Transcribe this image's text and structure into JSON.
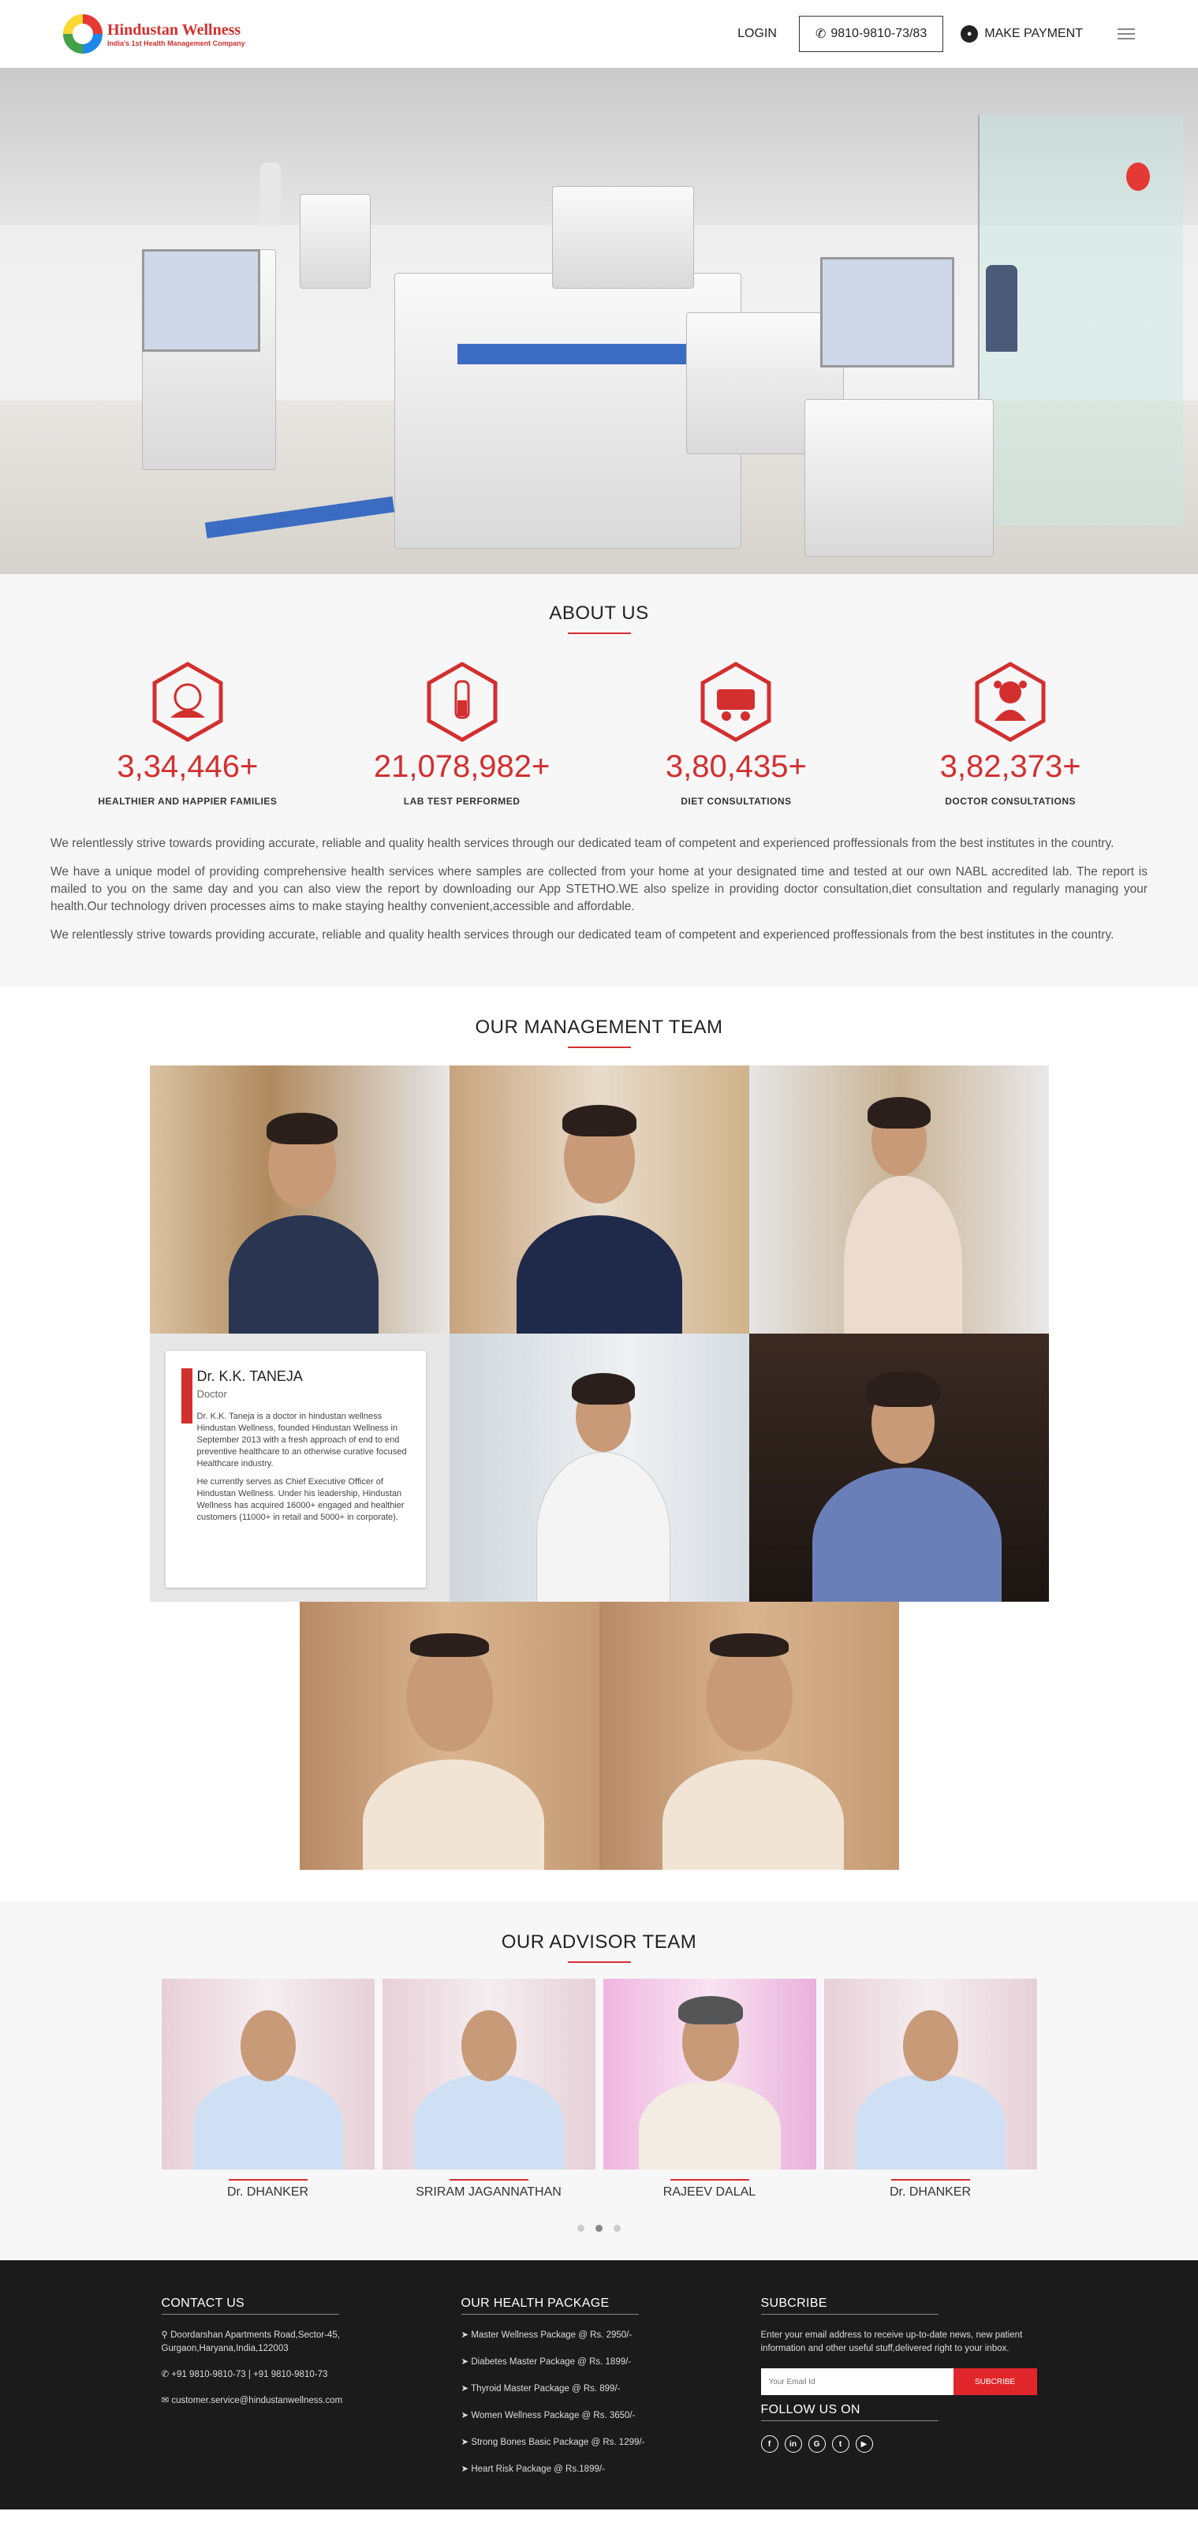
{
  "header": {
    "logo_title": "Hindustan Wellness",
    "logo_sub": "India's 1st Health Management Company",
    "login": "LOGIN",
    "phone": "9810-9810-73/83",
    "pay": "MAKE PAYMENT"
  },
  "about": {
    "title": "ABOUT US",
    "stats": [
      {
        "num": "3,34,446+",
        "label": "HEALTHIER AND HAPPIER FAMILIES",
        "icon": "family-icon"
      },
      {
        "num": "21,078,982+",
        "label": "LAB TEST PERFORMED",
        "icon": "test-tube-icon"
      },
      {
        "num": "3,80,435+",
        "label": "DIET CONSULTATIONS",
        "icon": "diet-icon"
      },
      {
        "num": "3,82,373+",
        "label": "DOCTOR CONSULTATIONS",
        "icon": "doctor-icon"
      }
    ],
    "paragraphs": [
      "We relentlessly strive towards providing accurate, reliable and quality health services through our dedicated team of competent and experienced proffessionals from the best institutes in the country.",
      "We have a unique model of providing comprehensive health services where samples are collected from your home at your designated time and tested at our own NABL accredited lab. The report is mailed to you on the same day and you can also view the report by downloading our App STETHO.WE also spelize in providing doctor consultation,diet consultation and regularly managing your health.Our technology driven processes aims to make staying healthy convenient,accessible and affordable.",
      "We relentlessly strive towards providing accurate, reliable and quality health services through our dedicated team of competent and experienced proffessionals from the best institutes in the country."
    ]
  },
  "management": {
    "title": "OUR MANAGEMENT TEAM",
    "profile": {
      "name": "Dr. K.K. TANEJA",
      "role": "Doctor",
      "text1": "Dr. K.K. Taneja is a doctor in hindustan wellness Hindustan Wellness, founded Hindustan Wellness in September 2013 with a fresh approach of end to end preventive healthcare to an otherwise curative focused Healthcare industry.",
      "text2": "He currently serves as Chief Executive Officer of Hindustan Wellness. Under his leadership, Hindustan Wellness has acquired 16000+ engaged and healthier customers (11000+ in retail and 5000+ in corporate)."
    }
  },
  "advisor": {
    "title": "OUR ADVISOR TEAM",
    "members": [
      {
        "name": "Dr. DHANKER"
      },
      {
        "name": "SRIRAM JAGANNATHAN"
      },
      {
        "name": "RAJEEV DALAL"
      },
      {
        "name": "Dr. DHANKER"
      }
    ]
  },
  "footer": {
    "contact_title": "CONTACT US",
    "address": "Doordarshan Apartments Road,Sector-45, Gurgaon,Haryana,India,122003",
    "phones": "+91 9810-9810-73 | +91 9810-9810-73",
    "email": "customer.service@hindustanwellness.com",
    "package_title": "OUR HEALTH PACKAGE",
    "packages": [
      "Master Wellness Package @ Rs. 2950/-",
      "Diabetes Master Package @ Rs. 1899/-",
      "Thyroid Master Package @ Rs. 899/-",
      "Women Wellness Package @ Rs. 3650/-",
      "Strong Bones Basic Package @ Rs. 1299/-",
      "Heart Risk Package @ Rs.1899/-"
    ],
    "subscribe_title": "SUBCRIBE",
    "subscribe_text": "Enter your email address to receive up-to-date news, new patient information and other useful stuff,delivered right to your inbox.",
    "email_placeholder": "Your Email Id",
    "subscribe_btn": "SUBCRIBE",
    "follow_title": "FOLLOW US ON"
  },
  "colors": {
    "accent": "#d32f2f",
    "footer_bg": "#1b1b1b"
  }
}
